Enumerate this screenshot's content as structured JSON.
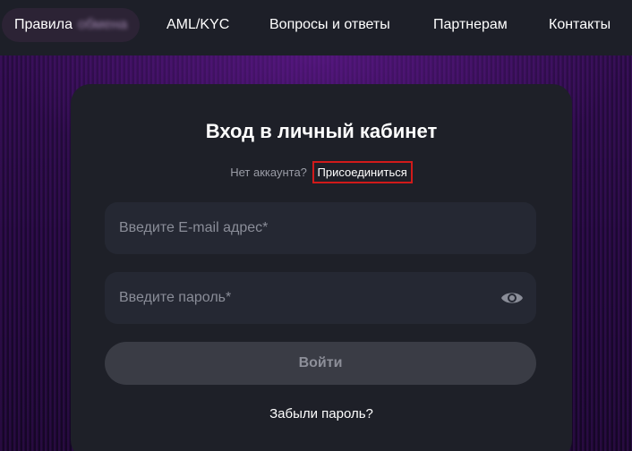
{
  "nav": {
    "rules_label": "Правила",
    "rules_blurred": "обмена",
    "aml_label": "AML/KYC",
    "faq_label": "Вопросы и ответы",
    "partners_label": "Партнерам",
    "contacts_label": "Контакты"
  },
  "login": {
    "title": "Вход в личный кабинет",
    "no_account_text": "Нет аккаунта?",
    "join_link": "Присоединиться",
    "email_placeholder": "Введите E-mail адрес*",
    "email_value": "",
    "password_placeholder": "Введите пароль*",
    "password_value": "",
    "show_password_icon": "eye-icon",
    "submit_label": "Войти",
    "forgot_link": "Забыли пароль?"
  },
  "colors": {
    "background_top": "#1d1f28",
    "background_glow": "#2a0c45",
    "card": "#1e2028",
    "field": "#252833",
    "button_disabled": "#3a3c45",
    "highlight_box": "#d11a1a"
  }
}
